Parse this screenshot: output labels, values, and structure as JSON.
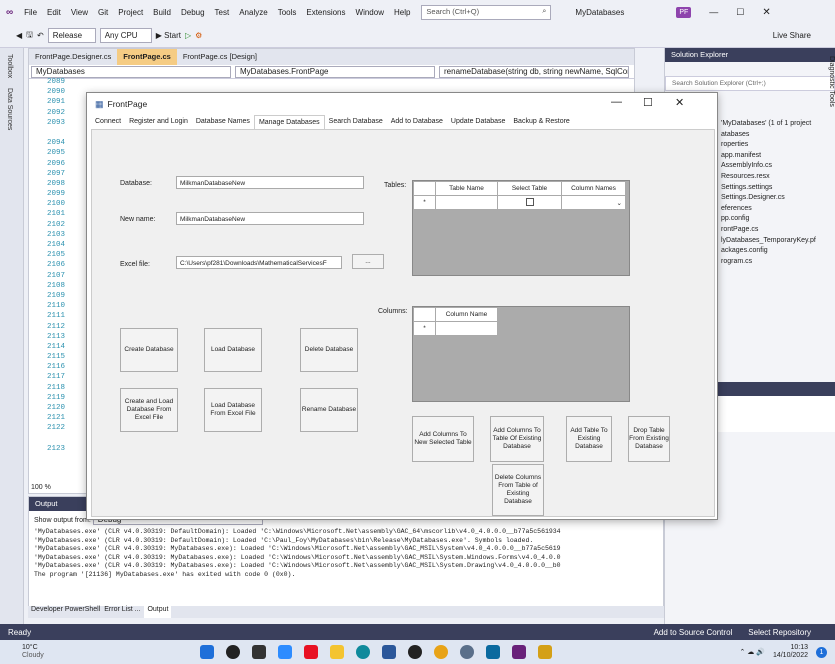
{
  "menu": [
    "File",
    "Edit",
    "View",
    "Git",
    "Project",
    "Build",
    "Debug",
    "Test",
    "Analyze",
    "Tools",
    "Extensions",
    "Window",
    "Help"
  ],
  "search_placeholder": "Search (Ctrl+Q)",
  "solution_name": "MyDatabases",
  "user_badge": "PF",
  "toolbar": {
    "config": "Release",
    "platform": "Any CPU",
    "start": "Start",
    "live_share": "Live Share"
  },
  "editor": {
    "tabs": [
      "FrontPage.Designer.cs",
      "FrontPage.cs",
      "FrontPage.cs [Design]"
    ],
    "nav_left": "MyDatabases",
    "nav_mid": "MyDatabases.FrontPage",
    "nav_right": "renameDatabase(string db, string newName, SqlConn",
    "zoom": "100 %",
    "line_numbers": [
      "2089",
      "2090",
      "2091",
      "2092",
      "2093",
      "",
      "2094",
      "2095",
      "2096",
      "2097",
      "2098",
      "2099",
      "2100",
      "2101",
      "2102",
      "2103",
      "2104",
      "2105",
      "2106",
      "2107",
      "2108",
      "2109",
      "2110",
      "2111",
      "2112",
      "2113",
      "2114",
      "2115",
      "2116",
      "2117",
      "2118",
      "2119",
      "2120",
      "2121",
      "2122",
      "",
      "2123"
    ]
  },
  "side_tabs": [
    "Toolbox",
    "Data Sources"
  ],
  "right_side_tab": "Diagnostic Tools",
  "form": {
    "title": "FrontPage",
    "tabs": [
      "Connect",
      "Register and Login",
      "Database Names",
      "Manage Databases",
      "Search Database",
      "Add to Database",
      "Update Database",
      "Backup & Restore"
    ],
    "database_label": "Database:",
    "database_value": "MilkmanDatabaseNew",
    "newname_label": "New name:",
    "newname_value": "MilkmanDatabaseNew",
    "excel_label": "Excel file:",
    "excel_value": "C:\\Users\\pf281\\Downloads\\MathematicalServicesF",
    "browse": "...",
    "tables_label": "Tables:",
    "columns_label": "Columns:",
    "tables_headers": [
      "Table Name",
      "Select Table",
      "Column Names"
    ],
    "columns_headers": [
      "Column Name"
    ],
    "row_marker": "*",
    "buttons": {
      "create": "Create Database",
      "load": "Load Database",
      "delete": "Delete Database",
      "create_load_excel": "Create and Load Database From Excel File",
      "load_excel": "Load Database From Excel File",
      "rename": "Rename Database",
      "add_cols_new": "Add Columns To New Selected Table",
      "add_cols_existing": "Add Columns To Table Of Existing Database",
      "add_table": "Add Table To Existing Database",
      "drop_table": "Drop Table From Existing Database",
      "delete_cols": "Delete Columns From Table of Existing Database"
    }
  },
  "solution_explorer": {
    "title": "Solution Explorer",
    "search": "Search Solution Explorer (Ctrl+;)",
    "items": [
      "'MyDatabases' (1 of 1 project",
      "atabases",
      "roperties",
      "app.manifest",
      "AssemblyInfo.cs",
      "Resources.resx",
      "Settings.settings",
      "Settings.Designer.cs",
      "eferences",
      "pp.config",
      "rontPage.cs",
      "lyDatabases_TemporaryKey.pf",
      "ackages.config",
      "rogram.cs"
    ]
  },
  "output": {
    "title": "Output",
    "show_from_label": "Show output from:",
    "show_from_value": "Debug",
    "lines": [
      "'MyDatabases.exe' (CLR v4.0.30319: DefaultDomain): Loaded 'C:\\Windows\\Microsoft.Net\\assembly\\GAC_64\\mscorlib\\v4.0_4.0.0.0__b77a5c561934",
      "'MyDatabases.exe' (CLR v4.0.30319: DefaultDomain): Loaded 'C:\\Paul_Foy\\MyDatabases\\bin\\Release\\MyDatabases.exe'. Symbols loaded.",
      "'MyDatabases.exe' (CLR v4.0.30319: MyDatabases.exe): Loaded 'C:\\Windows\\Microsoft.Net\\assembly\\GAC_MSIL\\System\\v4.0_4.0.0.0__b77a5c5619",
      "'MyDatabases.exe' (CLR v4.0.30319: MyDatabases.exe): Loaded 'C:\\Windows\\Microsoft.Net\\assembly\\GAC_MSIL\\System.Windows.Forms\\v4.0_4.0.0",
      "'MyDatabases.exe' (CLR v4.0.30319: MyDatabases.exe): Loaded 'C:\\Windows\\Microsoft.Net\\assembly\\GAC_MSIL\\System.Drawing\\v4.0_4.0.0.0__b0",
      "The program '[21136] MyDatabases.exe' has exited with code 0 (0x0)."
    ]
  },
  "bottom_tabs": [
    "Developer PowerShell",
    "Error List ...",
    "Output"
  ],
  "status": {
    "ready": "Ready",
    "source_control": "Add to Source Control",
    "repository": "Select Repository"
  },
  "taskbar": {
    "temp": "10°C",
    "weather": "Cloudy",
    "time": "10:13",
    "date": "14/10/2022"
  }
}
